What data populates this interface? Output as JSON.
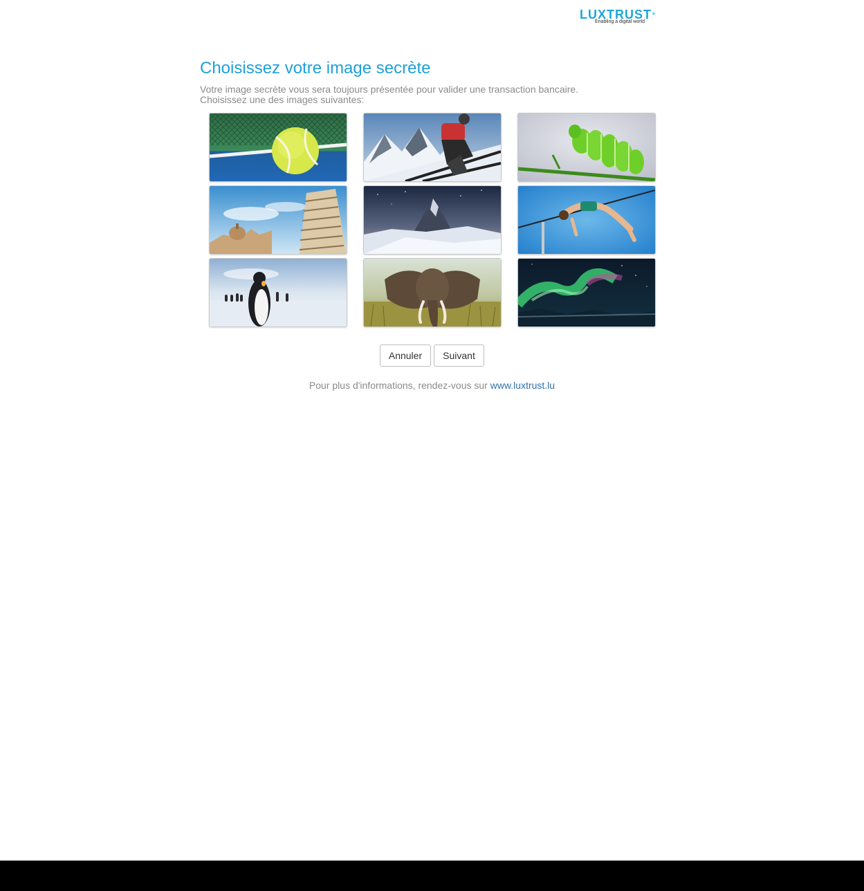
{
  "logo": {
    "word": "LUXTRUST",
    "mark": "®",
    "tagline": "Enabling a digital world"
  },
  "title": "Choisissez votre image secrète",
  "description": {
    "line1": "Votre image secrète vous sera toujours présentée pour valider une transaction bancaire.",
    "line2": "Choisissez une des images suivantes:"
  },
  "images": [
    {
      "name": "tennis-ball"
    },
    {
      "name": "skier"
    },
    {
      "name": "caterpillar"
    },
    {
      "name": "leaning-tower-pisa"
    },
    {
      "name": "matterhorn-night"
    },
    {
      "name": "high-jumper"
    },
    {
      "name": "penguins"
    },
    {
      "name": "elephant"
    },
    {
      "name": "aurora-borealis"
    }
  ],
  "buttons": {
    "cancel": "Annuler",
    "next": "Suivant"
  },
  "footer": {
    "text": "Pour plus d'informations, rendez-vous sur ",
    "link": "www.luxtrust.lu"
  },
  "colors": {
    "accent": "#1ea0d6",
    "link": "#2f6fa8",
    "text_muted": "#8a8a8a"
  }
}
